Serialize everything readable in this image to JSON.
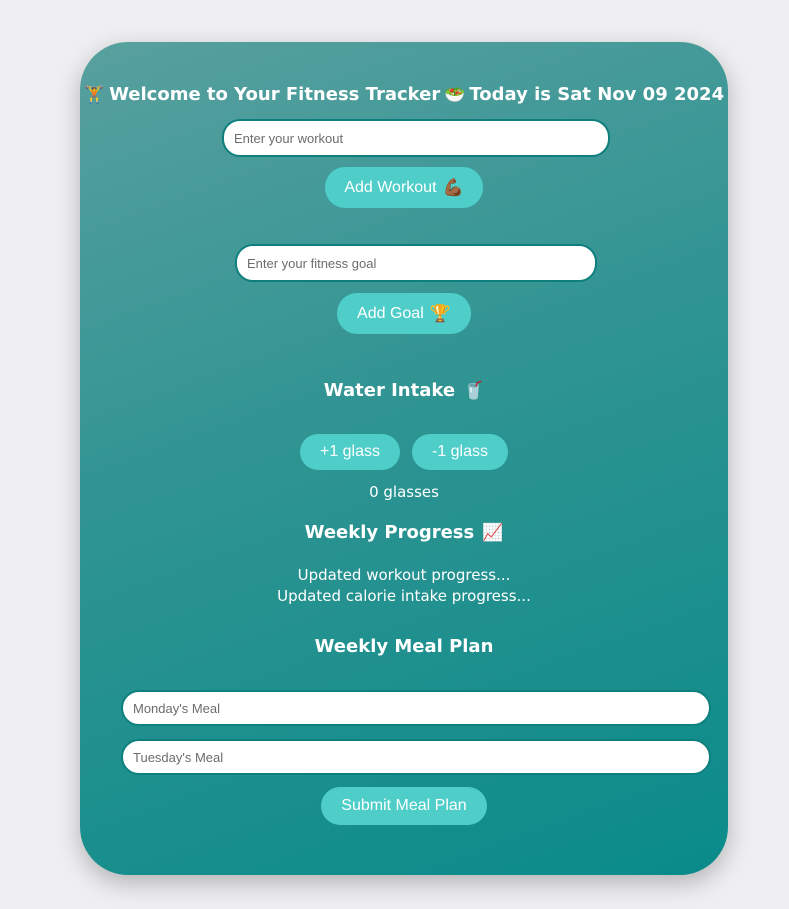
{
  "header": {
    "icon_left": "person-lifting-weights-emoji",
    "welcome": "Welcome to Your Fitness Tracker",
    "icon_mid": "salad-bowl-emoji",
    "date_text": "Today is Sat Nov 09 2024"
  },
  "workout": {
    "placeholder": "Enter your workout",
    "button_label": "Add Workout",
    "button_icon": "flexed-biceps-emoji"
  },
  "goal": {
    "placeholder": "Enter your fitness goal",
    "button_label": "Add Goal",
    "button_icon": "trophy-emoji"
  },
  "water": {
    "heading": "Water Intake",
    "heading_icon": "cup-with-straw-emoji",
    "plus_label": "+1 glass",
    "minus_label": "-1 glass",
    "count_text": "0 glasses"
  },
  "progress": {
    "heading": "Weekly Progress",
    "heading_icon": "chart-increasing-emoji",
    "line1": "Updated workout progress...",
    "line2": "Updated calorie intake progress..."
  },
  "meal_plan": {
    "heading": "Weekly Meal Plan",
    "monday_placeholder": "Monday's Meal",
    "tuesday_placeholder": "Tuesday's Meal",
    "submit_label": "Submit Meal Plan"
  },
  "colors": {
    "page_bg": "#efeff1",
    "card_gradient_start": "#58a09f",
    "card_gradient_end": "#098b8a",
    "button_bg": "#4ecdc9",
    "input_border": "#0e7f7c"
  }
}
